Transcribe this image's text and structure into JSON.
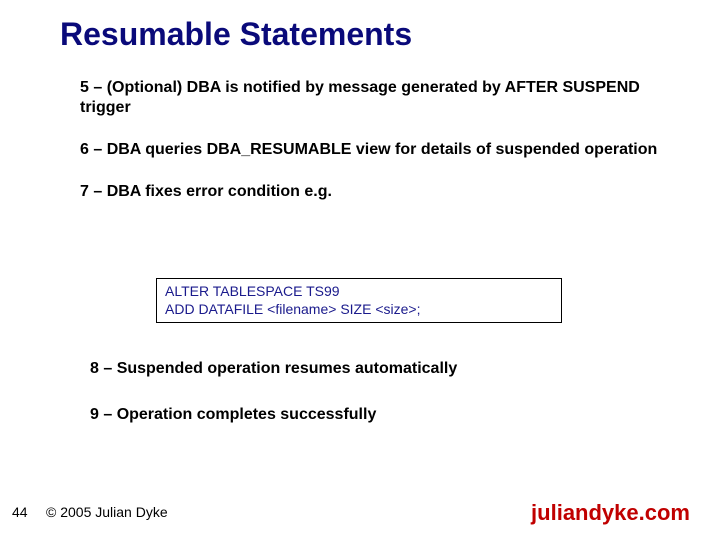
{
  "title": "Resumable Statements",
  "bullets": {
    "b1": "5 – (Optional) DBA is notified by message generated by AFTER SUSPEND trigger",
    "b2": "6 – DBA queries DBA_RESUMABLE view for details of suspended operation",
    "b3": "7 – DBA fixes error condition e.g.",
    "b4": "8 – Suspended operation resumes automatically",
    "b5": "9 – Operation completes successfully"
  },
  "code": {
    "line1": "ALTER TABLESPACE TS99",
    "line2": "ADD DATAFILE <filename> SIZE <size>;"
  },
  "footer": {
    "page": "44",
    "copyright": "© 2005 Julian Dyke",
    "site": "juliandyke.com"
  }
}
